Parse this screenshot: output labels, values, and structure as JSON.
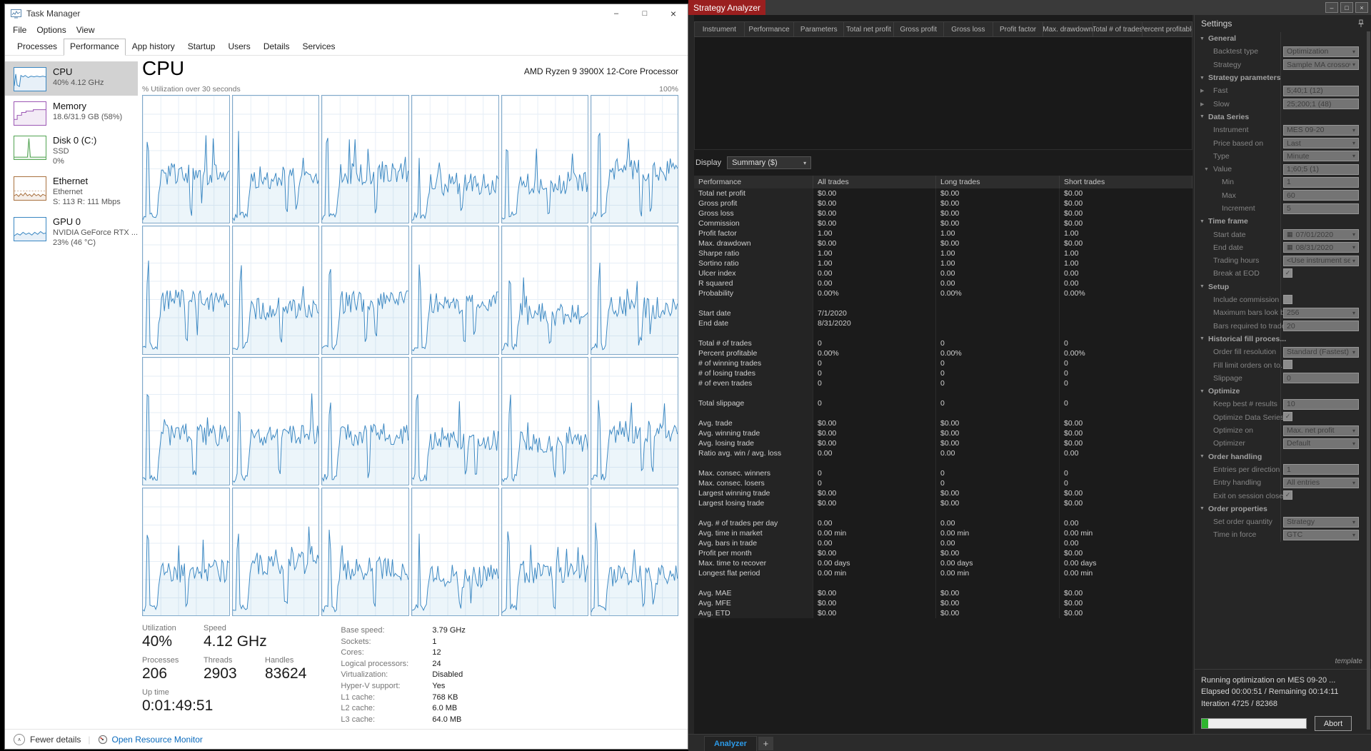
{
  "colors": {
    "cpu_blue": "#3a87c2",
    "memory_purple": "#9b57b4",
    "disk_green": "#52a352",
    "ethernet_brown": "#a9713f",
    "analyzer_red": "#9a1f1f",
    "link_blue": "#0b6bbd",
    "tab_blue": "#2c9ae8",
    "progress_green": "#2fb52f"
  },
  "icons": {
    "tm_minimize": "–",
    "tm_maximize": "□",
    "tm_close": "×",
    "sa_minimize": "–",
    "sa_maximize": "□",
    "sa_close": "×",
    "chevron_up": "∧",
    "dropdown_arrow": "▾",
    "section_open": "▼",
    "expander_closed": "▶",
    "calendar": "▦",
    "check": "✓",
    "add_tab": "+"
  },
  "task_manager": {
    "title": "Task Manager",
    "menu": [
      "File",
      "Options",
      "View"
    ],
    "tabs": [
      "Processes",
      "Performance",
      "App history",
      "Startup",
      "Users",
      "Details",
      "Services"
    ],
    "active_tab": "Performance",
    "sidebar": [
      {
        "id": "cpu",
        "title": "CPU",
        "lines": [
          "40% 4.12 GHz"
        ],
        "color": "#3a87c2",
        "selected": true
      },
      {
        "id": "memory",
        "title": "Memory",
        "lines": [
          "18.6/31.9 GB (58%)"
        ],
        "color": "#9b57b4",
        "selected": false
      },
      {
        "id": "disk",
        "title": "Disk 0 (C:)",
        "lines": [
          "SSD",
          "0%"
        ],
        "color": "#52a352",
        "selected": false
      },
      {
        "id": "ethernet",
        "title": "Ethernet",
        "lines": [
          "Ethernet",
          "S: 113 R: 111 Mbps"
        ],
        "color": "#a9713f",
        "selected": false
      },
      {
        "id": "gpu",
        "title": "GPU 0",
        "lines": [
          "NVIDIA GeForce RTX ...",
          "23% (46 °C)"
        ],
        "color": "#3a87c2",
        "selected": false
      }
    ],
    "main": {
      "title": "CPU",
      "subtitle_right": "AMD Ryzen 9 3900X 12-Core Processor",
      "graph_label": "% Utilization over 30 seconds",
      "graph_max": "100%",
      "grid": {
        "rows": 4,
        "cols": 6
      },
      "stats": {
        "utilization_label": "Utilization",
        "utilization": "40%",
        "speed_label": "Speed",
        "speed": "4.12 GHz",
        "processes_label": "Processes",
        "processes": "206",
        "threads_label": "Threads",
        "threads": "2903",
        "handles_label": "Handles",
        "handles": "83624",
        "uptime_label": "Up time",
        "uptime": "0:01:49:51"
      },
      "details": [
        {
          "label": "Base speed:",
          "value": "3.79 GHz"
        },
        {
          "label": "Sockets:",
          "value": "1"
        },
        {
          "label": "Cores:",
          "value": "12"
        },
        {
          "label": "Logical processors:",
          "value": "24"
        },
        {
          "label": "Virtualization:",
          "value": "Disabled"
        },
        {
          "label": "Hyper-V support:",
          "value": "Yes"
        },
        {
          "label": "L1 cache:",
          "value": "768 KB"
        },
        {
          "label": "L2 cache:",
          "value": "6.0 MB"
        },
        {
          "label": "L3 cache:",
          "value": "64.0 MB"
        }
      ],
      "footer": {
        "fewer_details": "Fewer details",
        "open_resource_monitor": "Open Resource Monitor"
      }
    }
  },
  "strategy_analyzer": {
    "title": "Strategy Analyzer",
    "results_columns": [
      "Instrument",
      "Performance",
      "Parameters",
      "Total net profit",
      "Gross profit",
      "Gross loss",
      "Profit factor",
      "Max. drawdown",
      "Total # of trades",
      "Percent profitable"
    ],
    "display_label": "Display",
    "display_value": "Summary ($)",
    "table": {
      "columns": [
        "Performance",
        "All trades",
        "Long trades",
        "Short trades"
      ],
      "rows": [
        [
          "Total net profit",
          "$0.00",
          "$0.00",
          "$0.00"
        ],
        [
          "Gross profit",
          "$0.00",
          "$0.00",
          "$0.00"
        ],
        [
          "Gross loss",
          "$0.00",
          "$0.00",
          "$0.00"
        ],
        [
          "Commission",
          "$0.00",
          "$0.00",
          "$0.00"
        ],
        [
          "Profit factor",
          "1.00",
          "1.00",
          "1.00"
        ],
        [
          "Max. drawdown",
          "$0.00",
          "$0.00",
          "$0.00"
        ],
        [
          "Sharpe ratio",
          "1.00",
          "1.00",
          "1.00"
        ],
        [
          "Sortino ratio",
          "1.00",
          "1.00",
          "1.00"
        ],
        [
          "Ulcer index",
          "0.00",
          "0.00",
          "0.00"
        ],
        [
          "R squared",
          "0.00",
          "0.00",
          "0.00"
        ],
        [
          "Probability",
          "0.00%",
          "0.00%",
          "0.00%"
        ],
        [
          "",
          "",
          "",
          ""
        ],
        [
          "Start date",
          "7/1/2020",
          "",
          ""
        ],
        [
          "End date",
          "8/31/2020",
          "",
          ""
        ],
        [
          "",
          "",
          "",
          ""
        ],
        [
          "Total # of trades",
          "0",
          "0",
          "0"
        ],
        [
          "Percent profitable",
          "0.00%",
          "0.00%",
          "0.00%"
        ],
        [
          "# of winning trades",
          "0",
          "0",
          "0"
        ],
        [
          "# of losing trades",
          "0",
          "0",
          "0"
        ],
        [
          "# of even trades",
          "0",
          "0",
          "0"
        ],
        [
          "",
          "",
          "",
          ""
        ],
        [
          "Total slippage",
          "0",
          "0",
          "0"
        ],
        [
          "",
          "",
          "",
          ""
        ],
        [
          "Avg. trade",
          "$0.00",
          "$0.00",
          "$0.00"
        ],
        [
          "Avg. winning trade",
          "$0.00",
          "$0.00",
          "$0.00"
        ],
        [
          "Avg. losing trade",
          "$0.00",
          "$0.00",
          "$0.00"
        ],
        [
          "Ratio avg. win / avg. loss",
          "0.00",
          "0.00",
          "0.00"
        ],
        [
          "",
          "",
          "",
          ""
        ],
        [
          "Max. consec. winners",
          "0",
          "0",
          "0"
        ],
        [
          "Max. consec. losers",
          "0",
          "0",
          "0"
        ],
        [
          "Largest winning trade",
          "$0.00",
          "$0.00",
          "$0.00"
        ],
        [
          "Largest losing trade",
          "$0.00",
          "$0.00",
          "$0.00"
        ],
        [
          "",
          "",
          "",
          ""
        ],
        [
          "Avg. # of trades per day",
          "0.00",
          "0.00",
          "0.00"
        ],
        [
          "Avg. time in market",
          "0.00 min",
          "0.00 min",
          "0.00 min"
        ],
        [
          "Avg. bars in trade",
          "0.00",
          "0.00",
          "0.00"
        ],
        [
          "Profit per month",
          "$0.00",
          "$0.00",
          "$0.00"
        ],
        [
          "Max. time to recover",
          "0.00 days",
          "0.00 days",
          "0.00 days"
        ],
        [
          "Longest flat period",
          "0.00 min",
          "0.00 min",
          "0.00 min"
        ],
        [
          "",
          "",
          "",
          ""
        ],
        [
          "Avg. MAE",
          "$0.00",
          "$0.00",
          "$0.00"
        ],
        [
          "Avg. MFE",
          "$0.00",
          "$0.00",
          "$0.00"
        ],
        [
          "Avg. ETD",
          "$0.00",
          "$0.00",
          "$0.00"
        ]
      ]
    },
    "tabs": {
      "analyzer": "Analyzer",
      "add": "+"
    },
    "settings": {
      "header": "Settings",
      "rows": [
        {
          "t": "section",
          "l": "General"
        },
        {
          "t": "dropdown",
          "l": "Backtest type",
          "v": "Optimization"
        },
        {
          "t": "dropdown",
          "l": "Strategy",
          "v": "Sample MA crossover"
        },
        {
          "t": "section",
          "l": "Strategy parameters"
        },
        {
          "t": "input",
          "l": "Fast",
          "v": "5;40;1 (12)",
          "exp": "closed"
        },
        {
          "t": "input",
          "l": "Slow",
          "v": "25;200;1 (48)",
          "exp": "closed"
        },
        {
          "t": "section",
          "l": "Data Series"
        },
        {
          "t": "dropdown",
          "l": "Instrument",
          "v": "MES 09-20"
        },
        {
          "t": "dropdown",
          "l": "Price based on",
          "v": "Last"
        },
        {
          "t": "dropdown",
          "l": "Type",
          "v": "Minute"
        },
        {
          "t": "input",
          "l": "Value",
          "v": "1;60;5 (1)",
          "exp": "open"
        },
        {
          "t": "input",
          "l": "Min",
          "v": "1",
          "ind": true
        },
        {
          "t": "input",
          "l": "Max",
          "v": "60",
          "ind": true
        },
        {
          "t": "input",
          "l": "Increment",
          "v": "5",
          "ind": true
        },
        {
          "t": "section",
          "l": "Time frame"
        },
        {
          "t": "date",
          "l": "Start date",
          "v": "07/01/2020"
        },
        {
          "t": "date",
          "l": "End date",
          "v": "08/31/2020"
        },
        {
          "t": "dropdown",
          "l": "Trading hours",
          "v": "<Use instrument set..."
        },
        {
          "t": "checkbox",
          "l": "Break at EOD",
          "chk": true
        },
        {
          "t": "section",
          "l": "Setup"
        },
        {
          "t": "checkbox",
          "l": "Include commission",
          "chk": false
        },
        {
          "t": "dropdown",
          "l": "Maximum bars look b...",
          "v": "256"
        },
        {
          "t": "input",
          "l": "Bars required to trade",
          "v": "20"
        },
        {
          "t": "section",
          "l": "Historical fill proces..."
        },
        {
          "t": "dropdown",
          "l": "Order fill resolution",
          "v": "Standard (Fastest)"
        },
        {
          "t": "checkbox",
          "l": "Fill limit orders on to...",
          "chk": false
        },
        {
          "t": "input",
          "l": "Slippage",
          "v": "0"
        },
        {
          "t": "section",
          "l": "Optimize"
        },
        {
          "t": "input",
          "l": "Keep best # results",
          "v": "10"
        },
        {
          "t": "checkbox",
          "l": "Optimize Data Series",
          "chk": true
        },
        {
          "t": "dropdown",
          "l": "Optimize on",
          "v": "Max. net profit"
        },
        {
          "t": "dropdown",
          "l": "Optimizer",
          "v": "Default"
        },
        {
          "t": "section",
          "l": "Order handling"
        },
        {
          "t": "input",
          "l": "Entries per direction",
          "v": "1"
        },
        {
          "t": "dropdown",
          "l": "Entry handling",
          "v": "All entries"
        },
        {
          "t": "checkbox",
          "l": "Exit on session close",
          "chk": true
        },
        {
          "t": "section",
          "l": "Order properties"
        },
        {
          "t": "dropdown",
          "l": "Set order quantity",
          "v": "Strategy"
        },
        {
          "t": "dropdown",
          "l": "Time in force",
          "v": "GTC"
        }
      ]
    },
    "status": {
      "template": "template",
      "line1": "Running optimization on MES 09-20 ...",
      "line2": "Elapsed 00:00:51 / Remaining 00:14:11",
      "line3": "Iteration 4725 / 82368",
      "progress_percent": 6,
      "abort_label": "Abort"
    }
  }
}
